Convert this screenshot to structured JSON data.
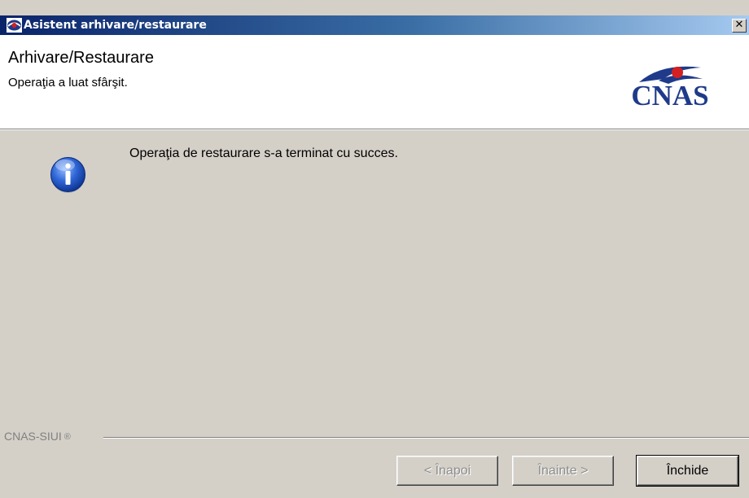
{
  "window": {
    "title": "Asistent arhivare/restaurare",
    "close_glyph": "✕"
  },
  "header": {
    "title": "Arhivare/Restaurare",
    "subtitle": "Operaţia a luat sfârşit.",
    "logo_text": "CNAS"
  },
  "content": {
    "icon": "info-icon",
    "message": "Operaţia de restaurare s-a terminat cu succes."
  },
  "footer": {
    "group_label": "CNAS-SIUI",
    "reg_mark": "®",
    "buttons": {
      "back": {
        "label": "< Înapoi",
        "enabled": false
      },
      "next": {
        "label": "Înainte >",
        "enabled": false
      },
      "close": {
        "label": "Închide",
        "enabled": true
      }
    }
  },
  "colors": {
    "title_bar_start": "#0a246a",
    "title_bar_end": "#a6caf0",
    "logo_blue": "#1f3a8a",
    "logo_red": "#d42020",
    "dialog_face": "#d4d0c8"
  }
}
